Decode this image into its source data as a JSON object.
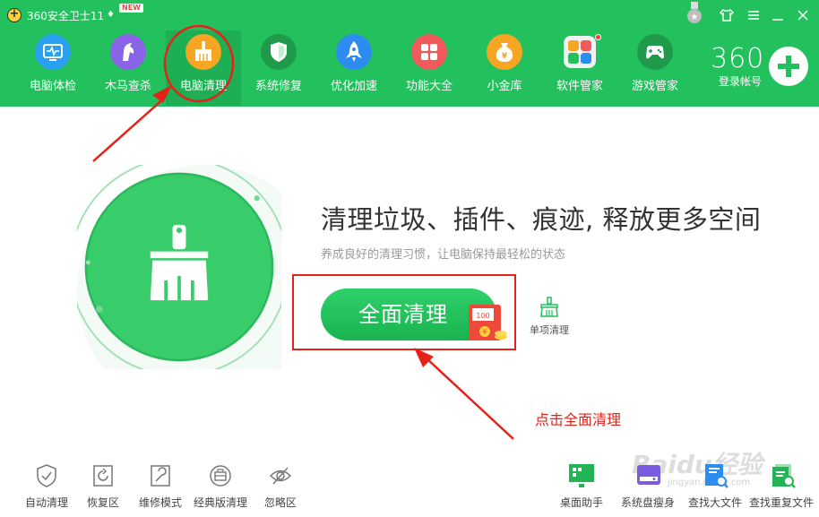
{
  "app": {
    "title": "360安全卫士11",
    "new_badge": "NEW"
  },
  "window_controls": [
    "shirt-icon",
    "menu-icon",
    "minimize-icon",
    "close-icon"
  ],
  "nav": [
    {
      "label": "电脑体检",
      "icon": "monitor-icon",
      "color": "#2aa1f0"
    },
    {
      "label": "木马查杀",
      "icon": "horse-icon",
      "color": "#8a63e6"
    },
    {
      "label": "电脑清理",
      "icon": "broom-icon",
      "color": "#f6a623",
      "active": true
    },
    {
      "label": "系统修复",
      "icon": "shield-icon",
      "color": "#1f9a4b"
    },
    {
      "label": "优化加速",
      "icon": "rocket-icon",
      "color": "#2c8cf0"
    },
    {
      "label": "功能大全",
      "icon": "grid-icon",
      "color": "#f05a5a"
    },
    {
      "label": "小金库",
      "icon": "moneybag-icon",
      "color": "#f6a623"
    },
    {
      "label": "软件管家",
      "icon": "flower-icon",
      "color": "#ffffff"
    },
    {
      "label": "游戏管家",
      "icon": "gamepad-icon",
      "color": "#1f9a4b"
    }
  ],
  "account": {
    "brand": "360",
    "login_label": "登录帐号"
  },
  "main": {
    "headline": "清理垃圾、插件、痕迹, 释放更多空间",
    "subtitle": "养成良好的清理习惯，让电脑保持最轻松的状态",
    "clean_button": "全面清理",
    "envelope_amount": "100",
    "single_clean": "单项清理",
    "annotation": "点击全面清理"
  },
  "bottom_left": [
    {
      "label": "自动清理",
      "icon": "shield-check-icon"
    },
    {
      "label": "恢复区",
      "icon": "restore-icon"
    },
    {
      "label": "维修模式",
      "icon": "wrench-icon"
    },
    {
      "label": "经典版清理",
      "icon": "briefcase-icon"
    },
    {
      "label": "忽略区",
      "icon": "eye-off-icon"
    }
  ],
  "bottom_right": [
    {
      "label": "桌面助手",
      "icon": "desktop-icon"
    },
    {
      "label": "系统盘瘦身",
      "icon": "disk-icon"
    },
    {
      "label": "查找大文件",
      "icon": "search-file-icon"
    },
    {
      "label": "查找重复文件",
      "icon": "duplicate-file-icon"
    }
  ],
  "watermark": {
    "text": "Baidu经验",
    "url": "jingyan.baidu.com"
  },
  "colors": {
    "header": "#22c15e",
    "active_tab": "#1eae54",
    "accent_red": "#e62117"
  }
}
